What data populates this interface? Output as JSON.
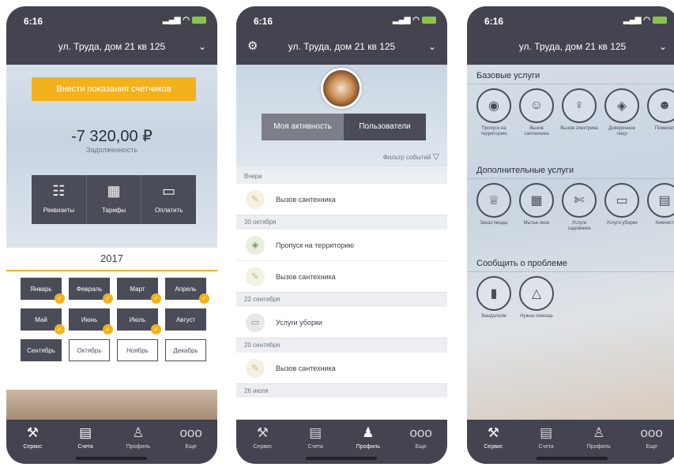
{
  "status": {
    "time": "6:16"
  },
  "header": {
    "address": "ул. Труда, дом 21 кв 125"
  },
  "tabbar": [
    {
      "label": "Сервис",
      "icon": "wrench-tools-icon"
    },
    {
      "label": "Счета",
      "icon": "invoice-icon"
    },
    {
      "label": "Профиль",
      "icon": "user-icon"
    },
    {
      "label": "Еще",
      "icon": "more-dots-icon"
    }
  ],
  "screen1": {
    "meter_button": "Внести показания счетчиков",
    "amount": "-7 320,00 ₽",
    "debt_label": "Задолженность",
    "quick_actions": [
      {
        "label": "Реквизиты",
        "icon": "requisites-icon"
      },
      {
        "label": "Тарифы",
        "icon": "calculator-icon"
      },
      {
        "label": "Оплатить",
        "icon": "wallet-icon"
      }
    ],
    "year": "2017",
    "months": [
      {
        "label": "Январь",
        "state": "filled",
        "checked": true
      },
      {
        "label": "Февраль",
        "state": "filled",
        "checked": true
      },
      {
        "label": "Март",
        "state": "filled",
        "checked": true
      },
      {
        "label": "Апрель",
        "state": "filled",
        "checked": true
      },
      {
        "label": "Май",
        "state": "filled",
        "checked": true
      },
      {
        "label": "Июнь",
        "state": "filled",
        "checked": true
      },
      {
        "label": "Июль",
        "state": "filled",
        "checked": true
      },
      {
        "label": "Август",
        "state": "filled",
        "checked": false
      },
      {
        "label": "Сентябрь",
        "state": "filled",
        "checked": false
      },
      {
        "label": "Октябрь",
        "state": "empty",
        "checked": false
      },
      {
        "label": "Ноябрь",
        "state": "empty",
        "checked": false
      },
      {
        "label": "Декабрь",
        "state": "empty",
        "checked": false
      }
    ]
  },
  "screen2": {
    "segments": [
      "Моя активность",
      "Пользователи"
    ],
    "filter_label": "Фильтр событий",
    "feed": [
      {
        "date": "Вчера",
        "items": [
          {
            "text": "Вызов сантехника",
            "icon": "wrench-icon"
          }
        ]
      },
      {
        "date": "30 октября",
        "items": [
          {
            "text": "Пропуск на территорию",
            "icon": "shield-icon"
          },
          {
            "text": "Вызов сантехника",
            "icon": "wrench-icon"
          }
        ]
      },
      {
        "date": "22 сентября",
        "items": [
          {
            "text": "Услуги уборки",
            "icon": "cleaning-icon"
          }
        ]
      },
      {
        "date": "20 сентября",
        "items": [
          {
            "text": "Вызов сантехника",
            "icon": "wrench-icon"
          }
        ]
      },
      {
        "date": "26 июля",
        "items": []
      }
    ]
  },
  "screen3": {
    "base_title": "Базовые услуги",
    "base": [
      {
        "label": "Пропуск на территорию",
        "icon": "shield-pass-icon"
      },
      {
        "label": "Вызов сантехника",
        "icon": "plumber-icon"
      },
      {
        "label": "Вызов электрика",
        "icon": "bulb-icon"
      },
      {
        "label": "Доверенное лицо",
        "icon": "trusted-person-icon"
      },
      {
        "label": "Помелат",
        "icon": "face-icon"
      }
    ],
    "extra_title": "Дополнительные услуги",
    "extra": [
      {
        "label": "Заказ пиццы",
        "icon": "chef-hat-icon"
      },
      {
        "label": "Мытье окон",
        "icon": "window-icon"
      },
      {
        "label": "Услуги садовника",
        "icon": "garden-icon"
      },
      {
        "label": "Услуги уборки",
        "icon": "cleaning-icon"
      },
      {
        "label": "Химчист",
        "icon": "dry-cleaning-icon"
      }
    ],
    "problem_title": "Сообщить о проблеме",
    "problem": [
      {
        "label": "Вандализм",
        "icon": "spray-can-icon"
      },
      {
        "label": "Нужна помощь",
        "icon": "warning-icon"
      }
    ]
  }
}
